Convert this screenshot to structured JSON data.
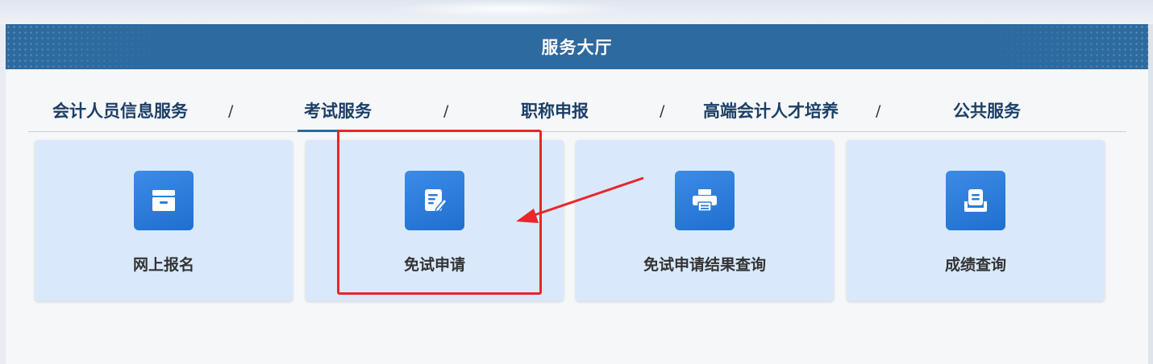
{
  "panel": {
    "title": "服务大厅"
  },
  "tabs": [
    {
      "label": "会计人员信息服务",
      "active": false
    },
    {
      "label": "考试服务",
      "active": true
    },
    {
      "label": "职称申报",
      "active": false
    },
    {
      "label": "高端会计人才培养",
      "active": false
    },
    {
      "label": "公共服务",
      "active": false
    }
  ],
  "separator": "/",
  "cards": [
    {
      "label": "网上报名",
      "icon": "archive-box-icon"
    },
    {
      "label": "免试申请",
      "icon": "edit-document-icon"
    },
    {
      "label": "免试申请结果查询",
      "icon": "printer-icon"
    },
    {
      "label": "成绩查询",
      "icon": "receipt-icon"
    }
  ],
  "colors": {
    "header": "#2d6a9f",
    "card_bg": "#d9e9fb",
    "icon_bg": "#2a7ddc",
    "annotation": "#e8262b"
  }
}
